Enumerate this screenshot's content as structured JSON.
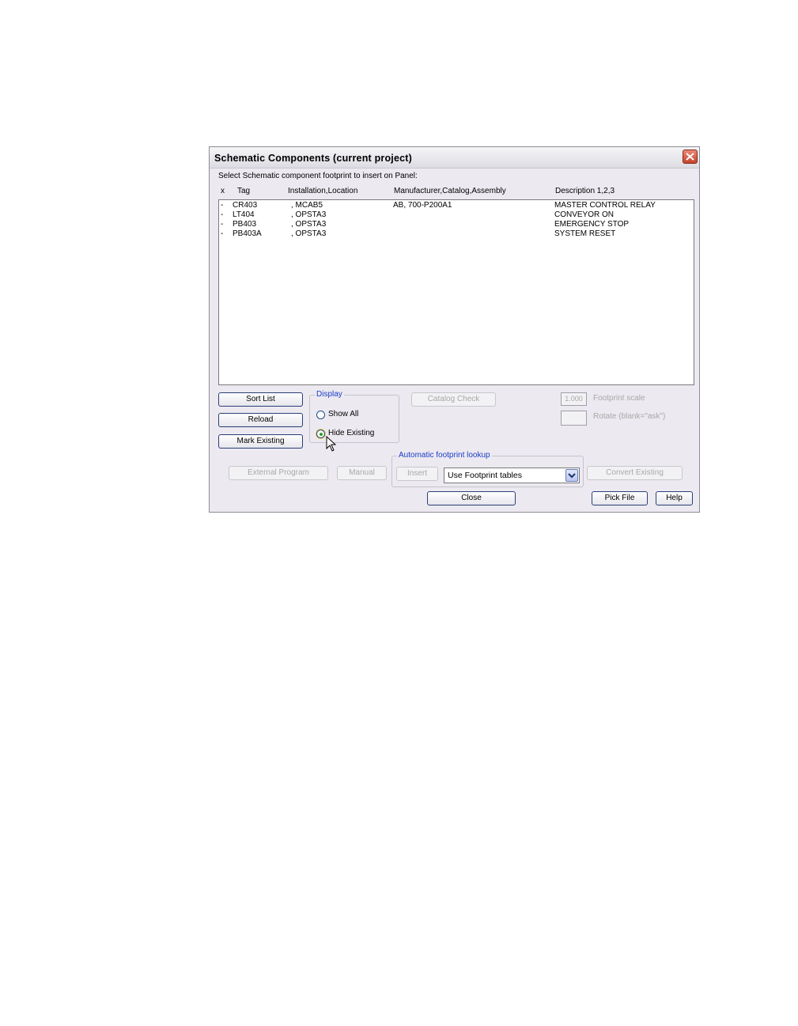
{
  "dialog": {
    "title": "Schematic Components (current project)",
    "instruction": "Select Schematic component footprint to insert on Panel:"
  },
  "columns": [
    "x",
    "Tag",
    "Installation,Location",
    "Manufacturer,Catalog,Assembly",
    "Description 1,2,3"
  ],
  "rows": [
    {
      "x": "-",
      "tag": "CR403",
      "location": ", MCAB5",
      "catalog": "AB, 700-P200A1",
      "description": "MASTER CONTROL RELAY"
    },
    {
      "x": "-",
      "tag": "LT404",
      "location": ", OPSTA3",
      "catalog": "",
      "description": "CONVEYOR ON"
    },
    {
      "x": "-",
      "tag": "PB403",
      "location": ", OPSTA3",
      "catalog": "",
      "description": "EMERGENCY STOP"
    },
    {
      "x": "-",
      "tag": "PB403A",
      "location": ", OPSTA3",
      "catalog": "",
      "description": "SYSTEM RESET"
    }
  ],
  "buttons": {
    "sort_list": "Sort List",
    "reload": "Reload",
    "mark_existing": "Mark Existing",
    "catalog_check": "Catalog Check",
    "external_program": "External Program",
    "manual": "Manual",
    "insert": "Insert",
    "convert_existing": "Convert Existing",
    "close": "Close",
    "pick_file": "Pick File",
    "help": "Help"
  },
  "display_group": {
    "legend": "Display",
    "show_all": "Show All",
    "hide_existing": "Hide Existing",
    "selected": "hide_existing"
  },
  "footprint": {
    "scale_value": "1.000",
    "scale_label": "Footprint scale",
    "rotate_value": "",
    "rotate_label": "Rotate (blank=\"ask\")"
  },
  "auto_lookup": {
    "legend": "Automatic footprint lookup",
    "selected_option": "Use Footprint tables"
  },
  "colors": {
    "dialog_bg": "#ece9f0",
    "legend_blue": "#1a3dc8",
    "close_red": "#c7442c"
  }
}
